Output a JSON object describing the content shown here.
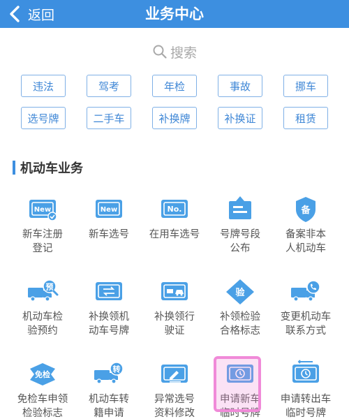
{
  "header": {
    "back_label": "返回",
    "title": "业务中心"
  },
  "search": {
    "placeholder": "搜索"
  },
  "tags": [
    "违法",
    "驾考",
    "年检",
    "事故",
    "挪车",
    "选号牌",
    "二手车",
    "补换牌",
    "补换证",
    "租赁"
  ],
  "section": {
    "title": "机动车业务"
  },
  "services": [
    {
      "name": "service-new-car-register",
      "icon": "new-plate-check-icon",
      "text": "New",
      "lines": [
        "新车注册",
        "登记"
      ]
    },
    {
      "name": "service-new-car-number",
      "icon": "new-plate-icon",
      "text": "New",
      "lines": [
        "新车选号"
      ]
    },
    {
      "name": "service-used-car-number",
      "icon": "no-plate-icon",
      "text": "No.",
      "lines": [
        "在用车选号"
      ]
    },
    {
      "name": "service-plate-segment",
      "icon": "notice-board-icon",
      "text": "",
      "lines": [
        "号牌号段",
        "公布"
      ]
    },
    {
      "name": "service-record-nonlocal",
      "icon": "record-shield-icon",
      "text": "备",
      "lines": [
        "备案非本",
        "人机动车"
      ]
    },
    {
      "name": "service-inspection-booking",
      "icon": "truck-booking-icon",
      "text": "预",
      "lines": [
        "机动车检",
        "验预约"
      ]
    },
    {
      "name": "service-replace-plate",
      "icon": "plate-exchange-icon",
      "text": "",
      "lines": [
        "补换领机",
        "动车号牌"
      ]
    },
    {
      "name": "service-replace-license",
      "icon": "license-car-icon",
      "text": "",
      "lines": [
        "补换领行",
        "驶证"
      ]
    },
    {
      "name": "service-inspection-mark",
      "icon": "inspection-diamond-icon",
      "text": "验",
      "lines": [
        "补领检验",
        "合格标志"
      ]
    },
    {
      "name": "service-change-contact",
      "icon": "truck-phone-icon",
      "text": "",
      "lines": [
        "变更机动车",
        "联系方式"
      ]
    },
    {
      "name": "service-exempt-mark",
      "icon": "exempt-badge-icon",
      "text": "免检",
      "lines": [
        "免检车申领",
        "检验标志"
      ]
    },
    {
      "name": "service-transfer",
      "icon": "truck-transfer-icon",
      "text": "转",
      "lines": [
        "机动车转",
        "籍申请"
      ]
    },
    {
      "name": "service-abnormal-number",
      "icon": "edit-plate-icon",
      "text": "",
      "lines": [
        "异常选号",
        "资料修改"
      ]
    },
    {
      "name": "service-temp-plate-new",
      "icon": "temp-plate-clock-icon",
      "text": "",
      "lines": [
        "申请新车",
        "临时号牌"
      ]
    },
    {
      "name": "service-temp-plate-out",
      "icon": "temp-plate-out-icon",
      "text": "",
      "lines": [
        "申请转出车",
        "临时号牌"
      ]
    }
  ],
  "colors": {
    "header": "#3d8fe0",
    "accent": "#3f87d6",
    "icon": "#4aa0e6",
    "highlight": "#f08ad8"
  }
}
